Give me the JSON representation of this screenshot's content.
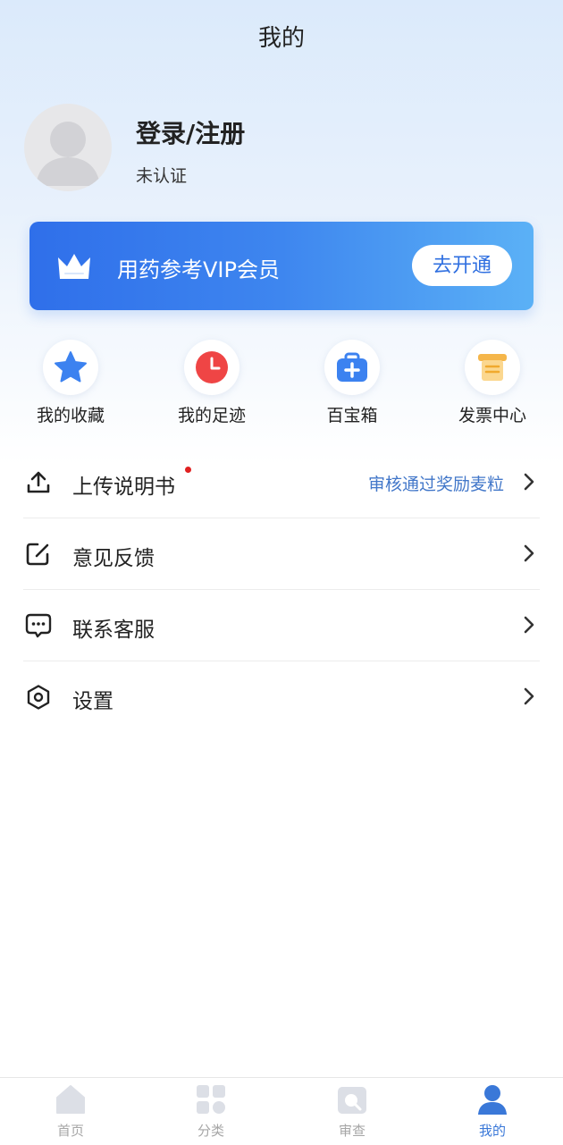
{
  "header": {
    "title": "我的"
  },
  "profile": {
    "name": "登录/注册",
    "status": "未认证"
  },
  "vip": {
    "text": "用药参考VIP会员",
    "button": "去开通",
    "icon": "crown-icon"
  },
  "quick_entries": [
    {
      "label": "我的收藏",
      "icon": "star-icon",
      "color": "#3c82f0"
    },
    {
      "label": "我的足迹",
      "icon": "clock-icon",
      "color": "#ef4545"
    },
    {
      "label": "百宝箱",
      "icon": "medkit-icon",
      "color": "#3c82f0"
    },
    {
      "label": "发票中心",
      "icon": "invoice-icon",
      "color": "#f5b64a"
    }
  ],
  "menu": [
    {
      "label": "上传说明书",
      "hint": "审核通过奖励麦粒",
      "icon": "upload-icon",
      "badge_dot": true
    },
    {
      "label": "意见反馈",
      "icon": "feedback-icon"
    },
    {
      "label": "联系客服",
      "icon": "chat-icon"
    },
    {
      "label": "设置",
      "icon": "settings-icon"
    }
  ],
  "tabbar": {
    "items": [
      {
        "label": "首页",
        "icon": "home-icon",
        "active": false
      },
      {
        "label": "分类",
        "icon": "grid-icon",
        "active": false
      },
      {
        "label": "审查",
        "icon": "review-icon",
        "active": false
      },
      {
        "label": "我的",
        "icon": "user-icon",
        "active": true
      }
    ],
    "active_color": "#3a78d8",
    "inactive_color": "#a6a6a6"
  },
  "colors": {
    "accent": "#2f6fea",
    "hint_blue": "#4277c9"
  }
}
